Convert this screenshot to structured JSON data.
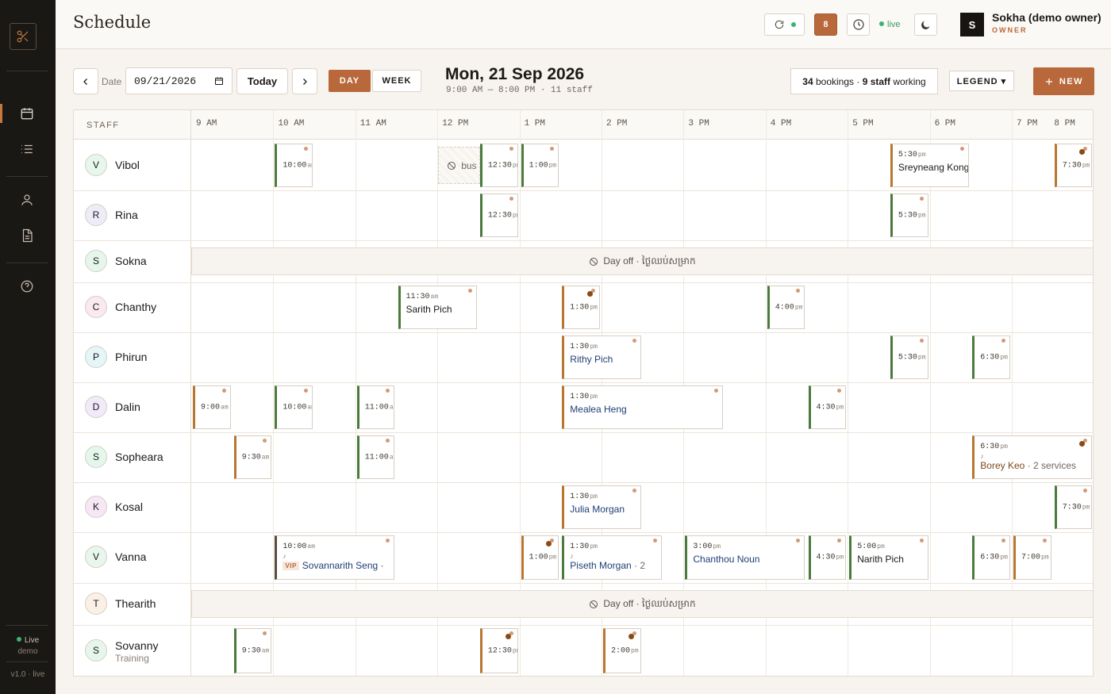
{
  "sidebar": {
    "nav": [
      "calendar-icon",
      "list-icon",
      "user-icon",
      "document-icon",
      "help-icon"
    ],
    "live_label": "Live",
    "demo_label": "demo",
    "version": "v1.0 · live"
  },
  "header": {
    "title": "Schedule",
    "badge_count": "8",
    "live_label": "live",
    "user_initial": "S",
    "user_name": "Sokha (demo owner)",
    "user_role": "OWNER"
  },
  "toolbar": {
    "date_label": "Date",
    "date_value": "09/21/2026",
    "today_label": "Today",
    "day_label": "DAY",
    "week_label": "WEEK",
    "date_heading": "Mon, 21 Sep 2026",
    "date_subheading": "9:00 AM — 8:00 PM · 11 staff",
    "summary_bookings": "34",
    "summary_bookings_label": " bookings · ",
    "summary_staff": "9 staff",
    "summary_staff_label": " working",
    "legend_label": "LEGEND ▾",
    "new_label": "NEW",
    "accent_color": "#b8683a"
  },
  "grid": {
    "staff_header": "STAFF",
    "hours": [
      "9 AM",
      "10 AM",
      "11 AM",
      "12 PM",
      "1 PM",
      "2 PM",
      "3 PM",
      "4 PM",
      "5 PM",
      "6 PM",
      "7 PM",
      "8 PM"
    ],
    "day_off_text": "Day off · ថ្ងៃឈប់សម្រាក",
    "busy_text": "bus",
    "staff": [
      {
        "initial": "V",
        "name": "Vibol",
        "avatar_color": "#e7f7ee"
      },
      {
        "initial": "R",
        "name": "Rina",
        "avatar_color": "#eeecf9"
      },
      {
        "initial": "S",
        "name": "Sokna",
        "avatar_color": "#e5f7ec",
        "day_off": true
      },
      {
        "initial": "C",
        "name": "Chanthy",
        "avatar_color": "#fbe9f1"
      },
      {
        "initial": "P",
        "name": "Phirun",
        "avatar_color": "#e5f6f8"
      },
      {
        "initial": "D",
        "name": "Dalin",
        "avatar_color": "#f2e9fa"
      },
      {
        "initial": "S",
        "name": "Sopheara",
        "avatar_color": "#e5f7ec"
      },
      {
        "initial": "K",
        "name": "Kosal",
        "avatar_color": "#f6e7f6"
      },
      {
        "initial": "V",
        "name": "Vanna",
        "avatar_color": "#e7f7ee"
      },
      {
        "initial": "T",
        "name": "Thearith",
        "avatar_color": "#fbf0e6",
        "day_off": true
      },
      {
        "initial": "S",
        "name": "Sovanny",
        "subtitle": "Training",
        "avatar_color": "#e5f7ec"
      }
    ],
    "bookings": [
      {
        "row": 0,
        "start": 10.0,
        "end": 10.5,
        "time": "10:00",
        "ampm": "am",
        "color": "green"
      },
      {
        "row": 0,
        "start": 12.5,
        "end": 13.0,
        "time": "12:30",
        "ampm": "pm",
        "color": "green"
      },
      {
        "row": 0,
        "start": 13.0,
        "end": 13.5,
        "time": "1:00",
        "ampm": "pm",
        "color": "green"
      },
      {
        "row": 0,
        "start": 17.5,
        "end": 18.5,
        "time": "5:30",
        "ampm": "pm",
        "client": "Sreyneang Kong",
        "client_color": "black",
        "color": "brown"
      },
      {
        "row": 0,
        "start": 19.5,
        "end": 20.0,
        "time": "7:30",
        "ampm": "pm",
        "color": "brown",
        "flag": true
      },
      {
        "row": 1,
        "start": 12.5,
        "end": 13.0,
        "time": "12:30",
        "ampm": "pm",
        "color": "green"
      },
      {
        "row": 1,
        "start": 17.5,
        "end": 18.0,
        "time": "5:30",
        "ampm": "pm",
        "color": "green"
      },
      {
        "row": 3,
        "start": 11.5,
        "end": 12.5,
        "time": "11:30",
        "ampm": "am",
        "client": "Sarith Pich",
        "client_color": "black",
        "color": "green"
      },
      {
        "row": 3,
        "start": 13.5,
        "end": 14.0,
        "time": "1:30",
        "ampm": "pm",
        "color": "brown",
        "flag": true
      },
      {
        "row": 3,
        "start": 16.0,
        "end": 16.5,
        "time": "4:00",
        "ampm": "pm",
        "color": "green"
      },
      {
        "row": 4,
        "start": 13.5,
        "end": 14.5,
        "time": "1:30",
        "ampm": "pm",
        "client": "Rithy Pich",
        "client_color": "blue",
        "color": "brown"
      },
      {
        "row": 4,
        "start": 17.5,
        "end": 18.0,
        "time": "5:30",
        "ampm": "pm",
        "color": "green"
      },
      {
        "row": 4,
        "start": 18.5,
        "end": 19.0,
        "time": "6:30",
        "ampm": "pm",
        "color": "green"
      },
      {
        "row": 5,
        "start": 9.0,
        "end": 9.5,
        "time": "9:00",
        "ampm": "am",
        "color": "brown"
      },
      {
        "row": 5,
        "start": 10.0,
        "end": 10.5,
        "time": "10:00",
        "ampm": "am",
        "color": "green"
      },
      {
        "row": 5,
        "start": 11.0,
        "end": 11.5,
        "time": "11:00",
        "ampm": "am",
        "color": "green"
      },
      {
        "row": 5,
        "start": 13.5,
        "end": 15.5,
        "time": "1:30",
        "ampm": "pm",
        "client": "Mealea Heng",
        "client_color": "blue",
        "color": "brown"
      },
      {
        "row": 5,
        "start": 16.5,
        "end": 17.0,
        "time": "4:30",
        "ampm": "pm",
        "color": "green"
      },
      {
        "row": 6,
        "start": 9.5,
        "end": 10.0,
        "time": "9:30",
        "ampm": "am",
        "color": "brown"
      },
      {
        "row": 6,
        "start": 11.0,
        "end": 11.5,
        "time": "11:00",
        "ampm": "am",
        "color": "green"
      },
      {
        "row": 6,
        "start": 18.5,
        "end": 20.0,
        "time": "6:30",
        "ampm": "pm",
        "client": "Borey Keo",
        "client_extra": " · 2 services",
        "client_color": "brown",
        "color": "brown",
        "flag": true,
        "note": "♪"
      },
      {
        "row": 7,
        "start": 13.5,
        "end": 14.5,
        "time": "1:30",
        "ampm": "pm",
        "client": "Julia Morgan",
        "client_color": "blue",
        "color": "brown"
      },
      {
        "row": 7,
        "start": 19.5,
        "end": 20.0,
        "time": "7:30",
        "ampm": "pm",
        "color": "green"
      },
      {
        "row": 8,
        "start": 10.0,
        "end": 11.5,
        "time": "10:00",
        "ampm": "am",
        "client": "Sovannarith Seng ·",
        "client_color": "blue",
        "color": "dark",
        "vip": "VIP",
        "note": "♪"
      },
      {
        "row": 8,
        "start": 13.0,
        "end": 13.5,
        "time": "1:00",
        "ampm": "pm",
        "color": "brown",
        "flag": true
      },
      {
        "row": 8,
        "start": 13.5,
        "end": 14.75,
        "time": "1:30",
        "ampm": "pm",
        "client": "Piseth Morgan",
        "client_extra": " · 2",
        "client_color": "blue",
        "color": "green",
        "note": "♪"
      },
      {
        "row": 8,
        "start": 15.0,
        "end": 16.5,
        "time": "3:00",
        "ampm": "pm",
        "client": "Chanthou Noun",
        "client_color": "blue",
        "color": "green"
      },
      {
        "row": 8,
        "start": 16.5,
        "end": 17.0,
        "time": "4:30",
        "ampm": "pm",
        "color": "green"
      },
      {
        "row": 8,
        "start": 17.0,
        "end": 18.0,
        "time": "5:00",
        "ampm": "pm",
        "client": "Narith Pich",
        "client_color": "black",
        "color": "green"
      },
      {
        "row": 8,
        "start": 18.5,
        "end": 19.0,
        "time": "6:30",
        "ampm": "pm",
        "color": "green"
      },
      {
        "row": 8,
        "start": 19.0,
        "end": 19.5,
        "time": "7:00",
        "ampm": "pm",
        "color": "brown"
      },
      {
        "row": 10,
        "start": 9.5,
        "end": 10.0,
        "time": "9:30",
        "ampm": "am",
        "color": "green"
      },
      {
        "row": 10,
        "start": 12.5,
        "end": 13.0,
        "time": "12:30",
        "ampm": "pm",
        "color": "brown",
        "flag": true
      },
      {
        "row": 10,
        "start": 14.0,
        "end": 14.5,
        "time": "2:00",
        "ampm": "pm",
        "color": "brown",
        "flag": true
      }
    ]
  }
}
